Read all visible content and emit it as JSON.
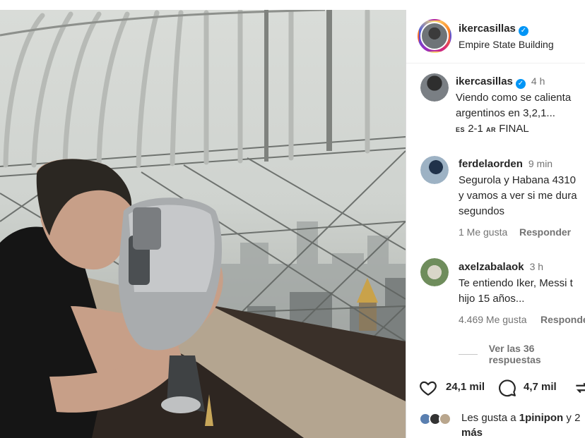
{
  "photo": {
    "alt_icons": [
      "binoculars-icon"
    ],
    "colors": {
      "sky": "#d4d7d3",
      "railing": "#8c8f8b",
      "wall": "#6b5a45",
      "binocular": "#a9acae"
    }
  },
  "header": {
    "username": "ikercasillas",
    "location": "Empire State Building"
  },
  "caption": {
    "username": "ikercasillas",
    "time": "4 h",
    "line1": "Viendo como se calienta",
    "line2": "argentinos en 3,2,1...",
    "score_prefix": "ES",
    "score": "2-1",
    "score_suffix": "AR",
    "score_status": "FINAL"
  },
  "comments": [
    {
      "username": "ferdelaorden",
      "time": "9 min",
      "lines": [
        "Segurola y Habana 4310",
        "y vamos a ver si me dura",
        "segundos"
      ],
      "likes": "1 Me gusta",
      "reply": "Responder"
    },
    {
      "username": "axelzabalaok",
      "time": "3 h",
      "lines": [
        "Te entiendo Iker, Messi t",
        "hijo 15 años..."
      ],
      "likes": "4.469 Me gusta",
      "reply": "Responde",
      "view_replies": "Ver las 36 respuestas"
    }
  ],
  "actions": {
    "like_count": "24,1 mil",
    "comment_count": "4,7 mil"
  },
  "liked_by": {
    "prefix": "Les gusta a",
    "user": "1pinipon",
    "suffix": "y 2",
    "more": "más"
  },
  "colors": {
    "accent": "#0095f6",
    "muted": "#737373",
    "text": "#262626"
  }
}
